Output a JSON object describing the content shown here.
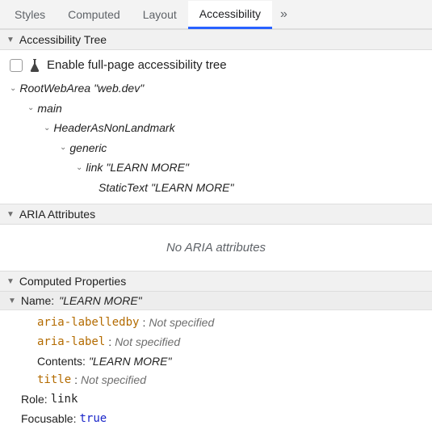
{
  "tabs": {
    "items": [
      "Styles",
      "Computed",
      "Layout",
      "Accessibility"
    ],
    "overflow": "»"
  },
  "sections": {
    "tree_header": "Accessibility Tree",
    "aria_header": "ARIA Attributes",
    "computed_header": "Computed Properties"
  },
  "enable": {
    "label": "Enable full-page accessibility tree"
  },
  "tree": {
    "n0_role": "RootWebArea",
    "n0_name": "\"web.dev\"",
    "n1_role": "main",
    "n2_role": "HeaderAsNonLandmark",
    "n3_role": "generic",
    "n4_role": "link",
    "n4_name": "\"LEARN MORE\"",
    "n5_role": "StaticText",
    "n5_name": "\"LEARN MORE\""
  },
  "aria": {
    "empty": "No ARIA attributes"
  },
  "computed": {
    "name_label": "Name:",
    "name_value": "\"LEARN MORE\"",
    "labelledby_k": "aria-labelledby",
    "labelledby_v": "Not specified",
    "arialabel_k": "aria-label",
    "arialabel_v": "Not specified",
    "contents_k": "Contents:",
    "contents_v": "\"LEARN MORE\"",
    "title_k": "title",
    "title_v": "Not specified",
    "role_k": "Role:",
    "role_v": "link",
    "focus_k": "Focusable:",
    "focus_v": "true",
    "colon": ":"
  }
}
